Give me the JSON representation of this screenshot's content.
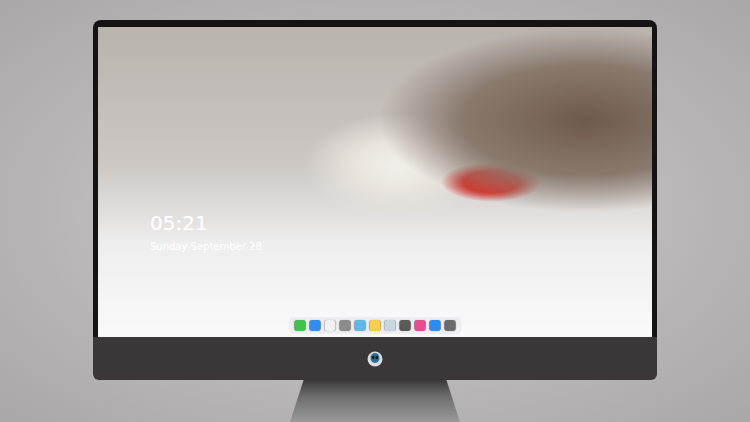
{
  "lock_screen": {
    "time": "05:21",
    "date": "Sunday September 28",
    "notice": "A new message arrived, it needs your attention. Tap to view details"
  },
  "dock": {
    "items": [
      {
        "color": "#3ec34a"
      },
      {
        "color": "#2f8ef0"
      },
      {
        "color": "#f2f2f2"
      },
      {
        "color": "#8c8c8c"
      },
      {
        "color": "#5fb7e8"
      },
      {
        "color": "#f7d04a"
      },
      {
        "color": "#c9d7e0"
      },
      {
        "color": "#5a5a5a"
      },
      {
        "color": "#e64f8f"
      },
      {
        "color": "#2d8cf0"
      },
      {
        "color": "#6b6b6b"
      }
    ]
  }
}
